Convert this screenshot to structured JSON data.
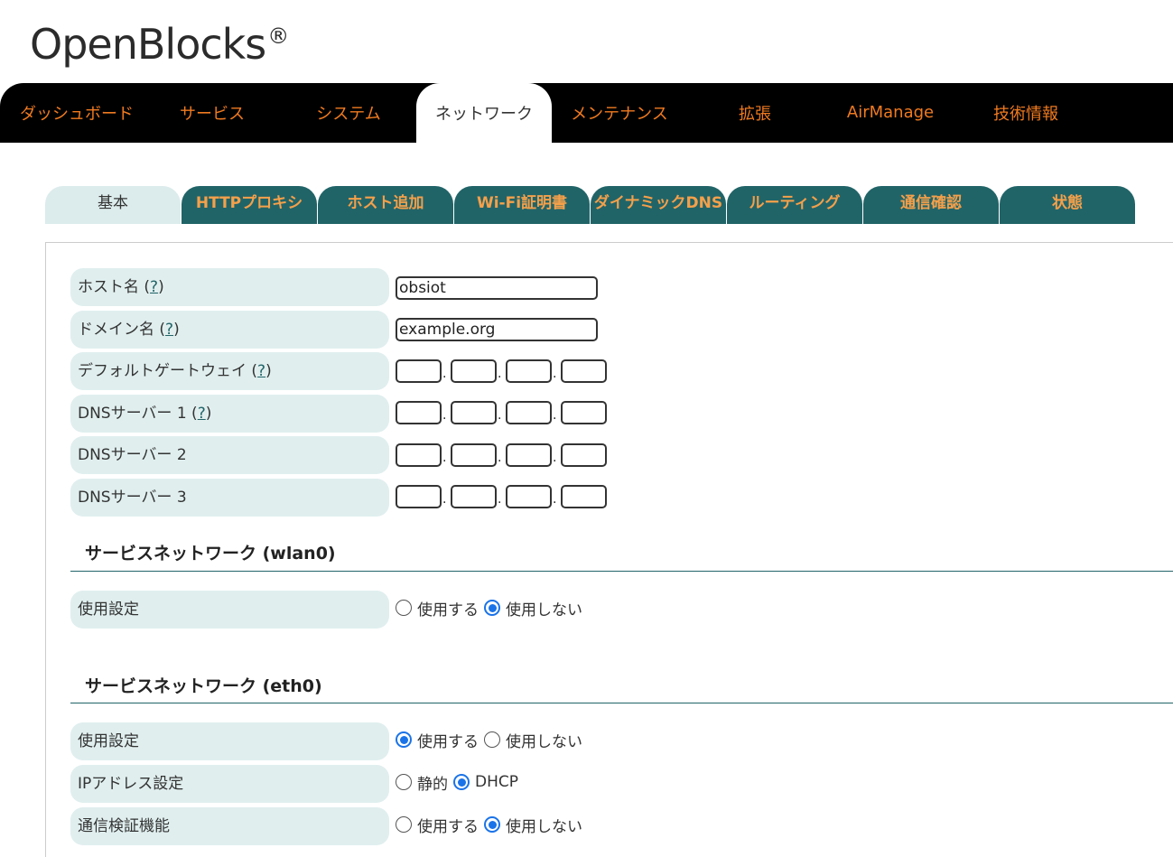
{
  "logo": {
    "text": "OpenBlocks",
    "mark": "®"
  },
  "nav": {
    "items": [
      {
        "label": "ダッシュボード"
      },
      {
        "label": "サービス"
      },
      {
        "label": "システム"
      },
      {
        "label": "ネットワーク"
      },
      {
        "label": "メンテナンス"
      },
      {
        "label": "拡張"
      },
      {
        "label": "AirManage"
      },
      {
        "label": "技術情報"
      }
    ],
    "active_index": 3
  },
  "subtabs": {
    "items": [
      {
        "label": "基本"
      },
      {
        "label": "HTTPプロキシ"
      },
      {
        "label": "ホスト追加"
      },
      {
        "label": "Wi-Fi証明書"
      },
      {
        "label": "ダイナミックDNS"
      },
      {
        "label": "ルーティング"
      },
      {
        "label": "通信確認"
      },
      {
        "label": "状態"
      }
    ],
    "active_index": 0
  },
  "basic": {
    "hostname": {
      "label": "ホスト名",
      "help": "?",
      "value": "obsiot"
    },
    "domain": {
      "label": "ドメイン名",
      "help": "?",
      "value": "example.org"
    },
    "gateway": {
      "label": "デフォルトゲートウェイ",
      "help": "?"
    },
    "dns1": {
      "label": "DNSサーバー 1",
      "help": "?"
    },
    "dns2": {
      "label": "DNSサーバー 2"
    },
    "dns3": {
      "label": "DNSサーバー 3"
    },
    "ip_separator": "."
  },
  "wlan0": {
    "title": "サービスネットワーク (wlan0)",
    "usage": {
      "label": "使用設定",
      "options": [
        "使用する",
        "使用しない"
      ],
      "selected": 1
    }
  },
  "eth0": {
    "title": "サービスネットワーク (eth0)",
    "usage": {
      "label": "使用設定",
      "options": [
        "使用する",
        "使用しない"
      ],
      "selected": 0
    },
    "ip_mode": {
      "label": "IPアドレス設定",
      "options": [
        "静的",
        "DHCP"
      ],
      "selected": 1
    },
    "verify": {
      "label": "通信検証機能",
      "options": [
        "使用する",
        "使用しない"
      ],
      "selected": 1
    }
  },
  "colors": {
    "nav_bg": "#000000",
    "nav_text": "#f07a20",
    "tab_bg": "#216468",
    "tab_text": "#f5a04a",
    "row_bg": "#e0eeee",
    "radio_checked": "#1a73e8"
  }
}
